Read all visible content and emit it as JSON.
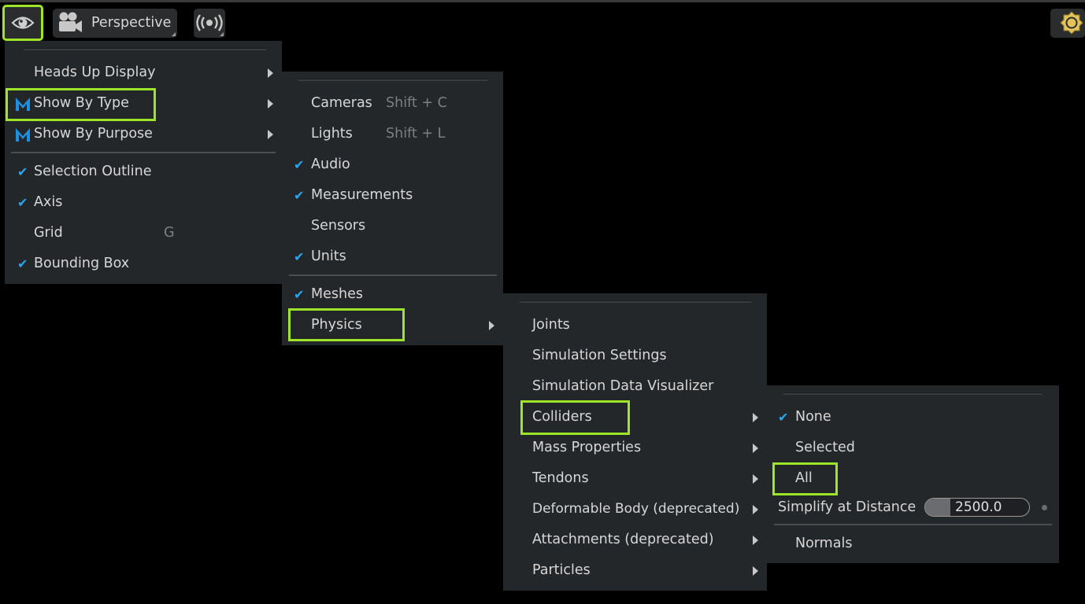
{
  "toolbar": {
    "camera_label": "Perspective"
  },
  "menu_main": {
    "items": [
      {
        "label": "Heads Up Display"
      },
      {
        "label": "Show By Type"
      },
      {
        "label": "Show By Purpose"
      },
      {
        "label": "Selection Outline"
      },
      {
        "label": "Axis"
      },
      {
        "label": "Grid",
        "shortcut": "G"
      },
      {
        "label": "Bounding Box"
      }
    ]
  },
  "menu_type": {
    "items": [
      {
        "label": "Cameras",
        "shortcut": "Shift + C"
      },
      {
        "label": "Lights",
        "shortcut": "Shift + L"
      },
      {
        "label": "Audio"
      },
      {
        "label": "Measurements"
      },
      {
        "label": "Sensors"
      },
      {
        "label": "Units"
      },
      {
        "label": "Meshes"
      },
      {
        "label": "Physics"
      }
    ]
  },
  "menu_physics": {
    "items": [
      {
        "label": "Joints"
      },
      {
        "label": "Simulation Settings"
      },
      {
        "label": "Simulation Data Visualizer"
      },
      {
        "label": "Colliders"
      },
      {
        "label": "Mass Properties"
      },
      {
        "label": "Tendons"
      },
      {
        "label": "Deformable Body (deprecated)"
      },
      {
        "label": "Attachments (deprecated)"
      },
      {
        "label": "Particles"
      }
    ]
  },
  "menu_colliders": {
    "items": [
      {
        "label": "None"
      },
      {
        "label": "Selected"
      },
      {
        "label": "All"
      }
    ],
    "simplify_label": "Simplify at Distance",
    "simplify_value": "2500.0",
    "normals_label": "Normals"
  },
  "colors": {
    "highlight": "#9ee52a",
    "check": "#2aa6f0",
    "menu_bg": "#24272a"
  }
}
